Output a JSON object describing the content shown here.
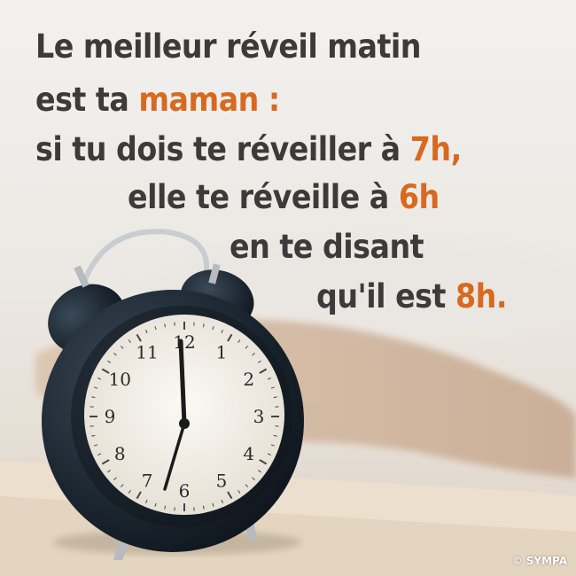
{
  "quote": {
    "line1": "Le meilleur réveil matin",
    "line2_prefix": "est ta ",
    "line2_highlight": "maman :",
    "line3_prefix": "si tu dois te réveiller à ",
    "line3_highlight": "7h,",
    "line4_prefix": "elle te réveille à ",
    "line4_highlight": "6h",
    "line5": "en te disant",
    "line6_prefix": "qu'il est ",
    "line6_highlight": "8h."
  },
  "clock": {
    "numerals": [
      "12",
      "1",
      "2",
      "3",
      "4",
      "5",
      "6",
      "7",
      "8",
      "9",
      "10",
      "11"
    ]
  },
  "credit": "© SYMPA",
  "colors": {
    "text": "#3c3a3a",
    "highlight": "#d8691f",
    "clock_body": "#1f2a35",
    "clock_face": "#f4f1ea"
  }
}
